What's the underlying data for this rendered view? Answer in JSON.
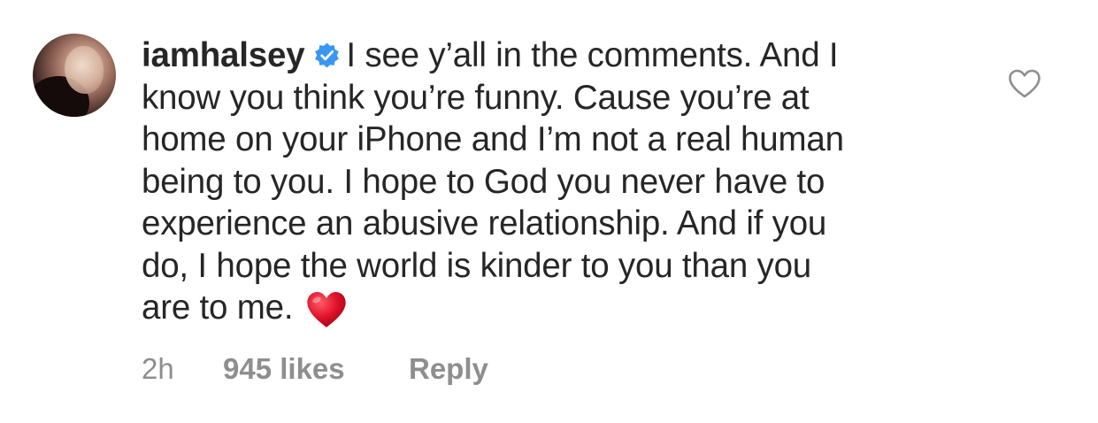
{
  "comment": {
    "username": "iamhalsey",
    "verified_icon": "verified-badge-icon",
    "text_lines": [
      "I see y’all in the comments. And I",
      "know you think you’re funny. Cause you’re at",
      "home on your iPhone and I’m not a real human",
      "being to you. I hope to God you never have to",
      "experience an abusive relationship. And if you",
      "do, I hope the world is kinder to you than you",
      "are to me."
    ],
    "emoji": "red-heart-emoji",
    "time": "2h",
    "likes": "945 likes",
    "reply_label": "Reply",
    "like_icon": "heart-outline-icon"
  },
  "colors": {
    "text": "#262626",
    "meta": "#8e8e8e",
    "verified_blue": "#3897f0",
    "emoji_red": "#e0132b",
    "like_icon_stroke": "#8e8e8e"
  }
}
